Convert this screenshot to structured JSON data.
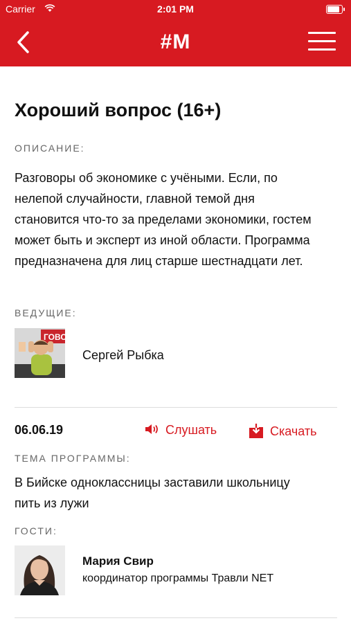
{
  "status_bar": {
    "carrier": "Carrier",
    "time": "2:01 PM"
  },
  "nav": {
    "logo": "#M"
  },
  "program": {
    "title": "Хороший вопрос (16+)",
    "description_label": "ОПИСАНИЕ:",
    "description": "Разговоры об экономике с учёными. Если, по нелепой случайности, главной темой дня становится что-то за пределами экономики, гостем может быть и эксперт из иной области. Программа предназначена для лиц старше шестнадцати лет.",
    "hosts_label": "ВЕДУЩИЕ:",
    "hosts": [
      {
        "name": "Сергей Рыбка"
      }
    ]
  },
  "episode": {
    "date": "06.06.19",
    "listen_label": "Слушать",
    "download_label": "Скачать",
    "topic_label": "ТЕМА ПРОГРАММЫ:",
    "topic": "В Бийске одноклассницы заставили школьницу пить из лужи",
    "guests_label": "ГОСТИ:",
    "guests": [
      {
        "name": "Мария Свир",
        "role": "координатор программы Травли NET"
      }
    ]
  },
  "colors": {
    "accent": "#d71a21"
  }
}
